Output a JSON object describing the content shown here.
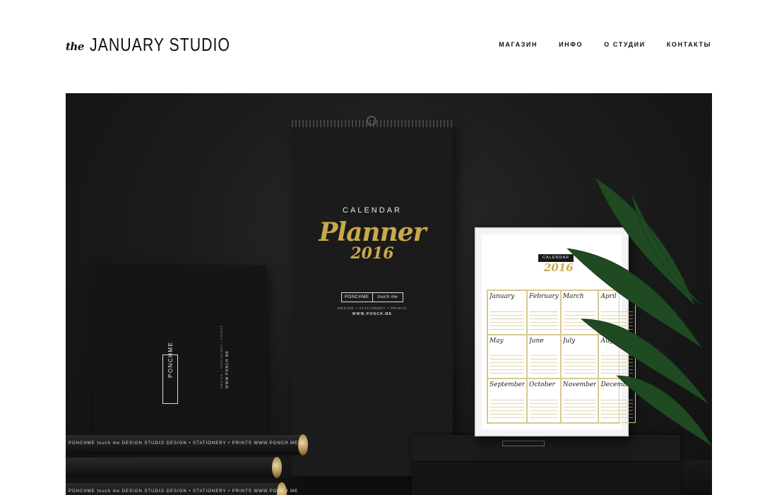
{
  "header": {
    "logo_prefix": "the",
    "logo_name": "JANUARY STUDIO"
  },
  "nav": {
    "items": [
      {
        "label": "МАГАЗИН"
      },
      {
        "label": "ИНФО"
      },
      {
        "label": "О СТУДИИ"
      },
      {
        "label": "КОНТАКТЫ"
      }
    ]
  },
  "hero": {
    "wall_calendar": {
      "title": "CALENDAR",
      "script": "Planner",
      "year": "2016",
      "brand": "PONCHME",
      "brand_script": "touch me",
      "tagline": "DESIGN • STATIONERY • PRINTS",
      "url": "WWW.PONCH.ME"
    },
    "box": {
      "brand": "PONCHME",
      "tagline": "DESIGN • STATIONERY • PRINTS",
      "url": "WWW.PONCH.ME"
    },
    "tube_label": "PONCHME  touch me  DESIGN STUDIO  DESIGN • STATIONERY • PRINTS  WWW.PONCH.ME",
    "framed_calendar": {
      "title": "CALENDAR",
      "year": "2016",
      "months": [
        "January",
        "February",
        "March",
        "April",
        "May",
        "June",
        "July",
        "August",
        "September",
        "October",
        "November",
        "December"
      ]
    }
  }
}
